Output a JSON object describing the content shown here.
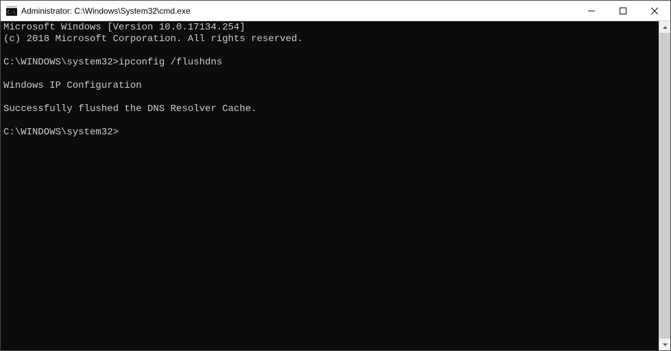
{
  "window": {
    "title": "Administrator: C:\\Windows\\System32\\cmd.exe"
  },
  "terminal": {
    "lines": [
      "Microsoft Windows [Version 10.0.17134.254]",
      "(c) 2018 Microsoft Corporation. All rights reserved.",
      "",
      "C:\\WINDOWS\\system32>ipconfig /flushdns",
      "",
      "Windows IP Configuration",
      "",
      "Successfully flushed the DNS Resolver Cache.",
      "",
      "C:\\WINDOWS\\system32>"
    ]
  }
}
